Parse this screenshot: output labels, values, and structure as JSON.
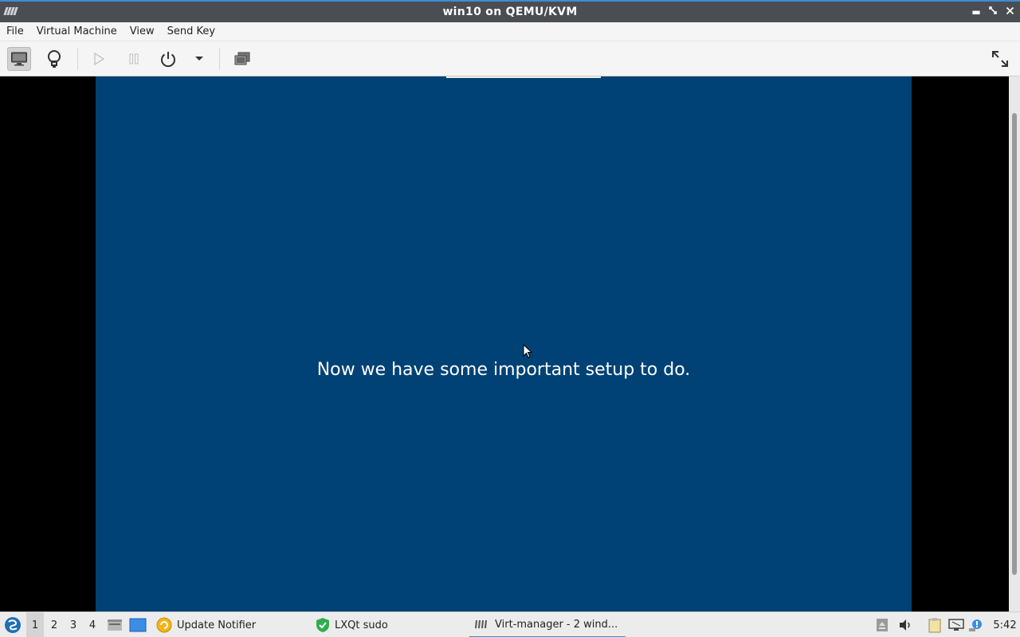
{
  "window": {
    "title": "win10 on QEMU/KVM"
  },
  "menu": {
    "items": [
      "File",
      "Virtual Machine",
      "View",
      "Send Key"
    ]
  },
  "toolbar": {
    "buttons": [
      "console-display",
      "details",
      "run",
      "pause",
      "shutdown",
      "shutdown-menu",
      "snapshots",
      "fullscreen"
    ]
  },
  "guest_screen": {
    "message": "Now we have some important setup to do.",
    "background": "#004275"
  },
  "taskbar": {
    "workspaces": [
      "1",
      "2",
      "3",
      "4"
    ],
    "active_workspace": "1",
    "tasks": [
      {
        "label": "Update Notifier",
        "icon": "update-notifier-icon"
      },
      {
        "label": "LXQt sudo",
        "icon": "shield-check-icon"
      },
      {
        "label": "Virt-manager - 2 wind...",
        "icon": "virt-manager-icon",
        "active": true
      }
    ],
    "clock": "5:42"
  },
  "colors": {
    "accent": "#3f8dd2",
    "titlebar": "#4a4d51"
  }
}
